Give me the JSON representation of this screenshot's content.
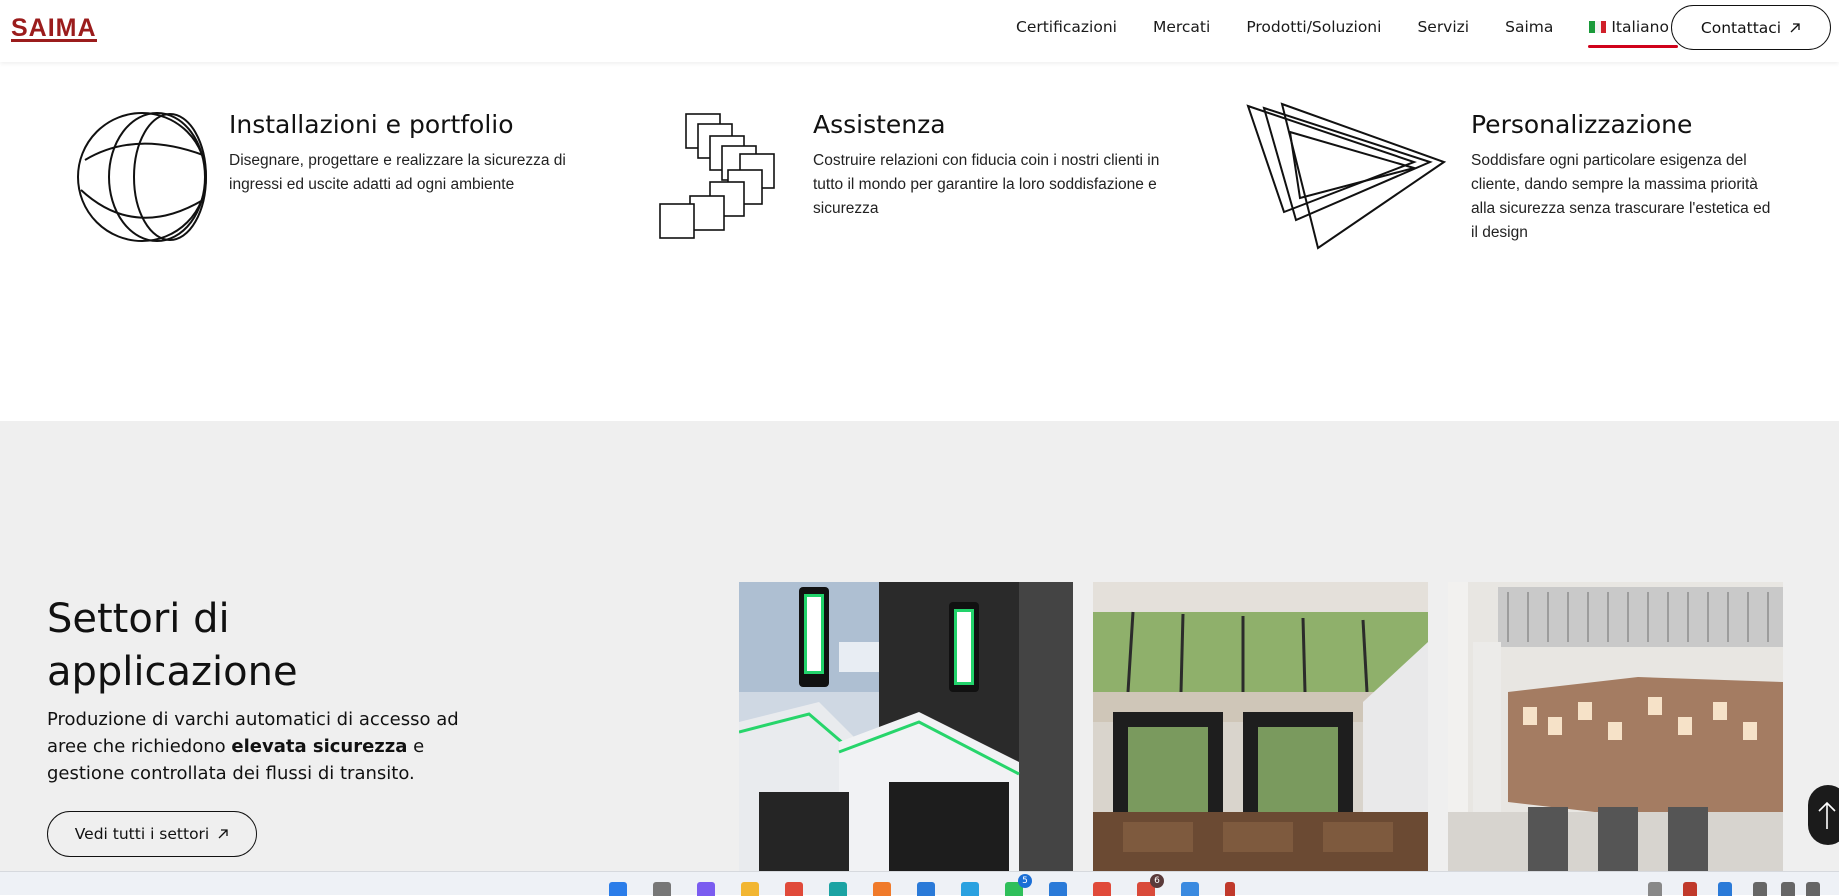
{
  "brand": {
    "logo_text": "SAIMA",
    "accent": "#9b1c1c"
  },
  "nav": {
    "items": [
      "Certificazioni",
      "Mercati",
      "Prodotti/Soluzioni",
      "Servizi",
      "Saima"
    ],
    "language": "Italiano",
    "active_underline_color": "#d0021b",
    "contact_label": "Contattaci"
  },
  "features": [
    {
      "title": "Installazioni e portfolio",
      "description": "Disegnare, progettare e realizzare la sicurezza di ingressi ed uscite adatti ad ogni ambiente",
      "icon": "spheres-icon"
    },
    {
      "title": "Assistenza",
      "description": "Costruire relazioni con fiducia coin i nostri clienti in tutto il mondo per garantire la loro soddisfazione e sicurezza",
      "icon": "stacked-squares-icon"
    },
    {
      "title": "Personalizzazione",
      "description": "Soddisfare ogni particolare esigenza del cliente, dando sempre la massima priorità alla sicurezza senza trascurare l'estetica ed il design",
      "icon": "layered-triangles-icon"
    }
  ],
  "sectors": {
    "title_line1": "Settori di",
    "title_line2": "applicazione",
    "desc_before": "Produzione di varchi automatici di accesso ad aree che richiedono ",
    "desc_bold": "elevata sicurezza",
    "desc_after": " e gestione controllata dei flussi di transito.",
    "button_label": "Vedi tutti i settori",
    "photos": [
      "airport-gates-photo",
      "revolving-doors-photo",
      "museum-turnstiles-photo"
    ]
  },
  "taskbar": {
    "badges": [
      "5",
      "6"
    ]
  }
}
